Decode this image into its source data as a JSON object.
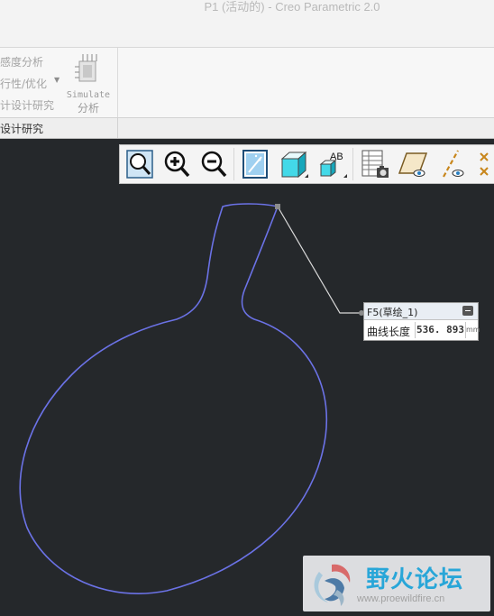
{
  "window": {
    "title": "P1 (活动的) - Creo Parametric 2.0"
  },
  "ribbon": {
    "items": [
      "感度分析",
      "行性/优化",
      "计设计研究"
    ],
    "simulate_label": "Simulate",
    "simulate_sub": "分析",
    "group_label": "设计研究"
  },
  "toolbar": {
    "buttons": [
      "refit-icon",
      "zoom-in-icon",
      "zoom-out-icon",
      "repaint-icon",
      "display-style-icon",
      "annotation-display-icon",
      "saved-views-icon",
      "camera-icon",
      "datum-plane-display-icon",
      "datum-axis-display-icon",
      "point-display-icon"
    ]
  },
  "info_popup": {
    "feature": "F5(草绘_1)",
    "key": "曲线长度",
    "value": "536. 893",
    "unit": "mm"
  },
  "watermark": {
    "title": "野火论坛",
    "url": "www.proewildfire.cn"
  },
  "colors": {
    "canvas": "#25282b",
    "curve": "#6b72e6",
    "leader": "#d9d9d9"
  }
}
